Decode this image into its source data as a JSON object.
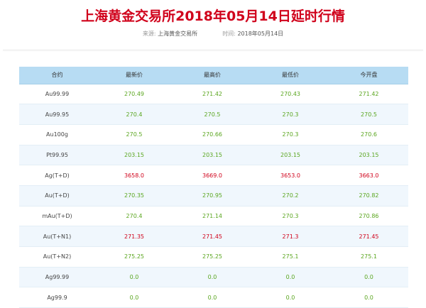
{
  "page": {
    "title": "上海黄金交易所2018年05月14日延时行情",
    "source_label": "来源:",
    "source_value": "上海黄金交易所",
    "time_label": "时间:",
    "time_value": "2018年05月14日"
  },
  "colors": {
    "title": "#d0021b",
    "header_bg": "#b7dcf3",
    "stripe_bg": "#f0f7fd",
    "price_up": "#d0021b",
    "price_down": "#5aa61f"
  },
  "table": {
    "headers": [
      "合约",
      "最新价",
      "最高价",
      "最低价",
      "今开盘"
    ],
    "rows": [
      {
        "name": "Au99.99",
        "last": "270.49",
        "high": "271.42",
        "low": "270.43",
        "open": "271.42",
        "trend": [
          "down",
          "down",
          "down",
          "down"
        ]
      },
      {
        "name": "Au99.95",
        "last": "270.4",
        "high": "270.5",
        "low": "270.3",
        "open": "270.5",
        "trend": [
          "down",
          "down",
          "down",
          "down"
        ]
      },
      {
        "name": "Au100g",
        "last": "270.5",
        "high": "270.66",
        "low": "270.3",
        "open": "270.6",
        "trend": [
          "down",
          "down",
          "down",
          "down"
        ]
      },
      {
        "name": "Pt99.95",
        "last": "203.15",
        "high": "203.15",
        "low": "203.15",
        "open": "203.15",
        "trend": [
          "down",
          "down",
          "down",
          "down"
        ]
      },
      {
        "name": "Ag(T+D)",
        "last": "3658.0",
        "high": "3669.0",
        "low": "3653.0",
        "open": "3663.0",
        "trend": [
          "up",
          "up",
          "up",
          "up"
        ]
      },
      {
        "name": "Au(T+D)",
        "last": "270.35",
        "high": "270.95",
        "low": "270.2",
        "open": "270.82",
        "trend": [
          "down",
          "down",
          "down",
          "down"
        ]
      },
      {
        "name": "mAu(T+D)",
        "last": "270.4",
        "high": "271.14",
        "low": "270.3",
        "open": "270.86",
        "trend": [
          "down",
          "down",
          "down",
          "down"
        ]
      },
      {
        "name": "Au(T+N1)",
        "last": "271.35",
        "high": "271.45",
        "low": "271.3",
        "open": "271.45",
        "trend": [
          "up",
          "up",
          "up",
          "up"
        ]
      },
      {
        "name": "Au(T+N2)",
        "last": "275.25",
        "high": "275.25",
        "low": "275.1",
        "open": "275.1",
        "trend": [
          "down",
          "down",
          "down",
          "down"
        ]
      },
      {
        "name": "Ag99.99",
        "last": "0.0",
        "high": "0.0",
        "low": "0.0",
        "open": "0.0",
        "trend": [
          "down",
          "down",
          "down",
          "down"
        ]
      },
      {
        "name": "Ag99.9",
        "last": "0.0",
        "high": "0.0",
        "low": "0.0",
        "open": "0.0",
        "trend": [
          "down",
          "down",
          "down",
          "down"
        ]
      }
    ]
  }
}
